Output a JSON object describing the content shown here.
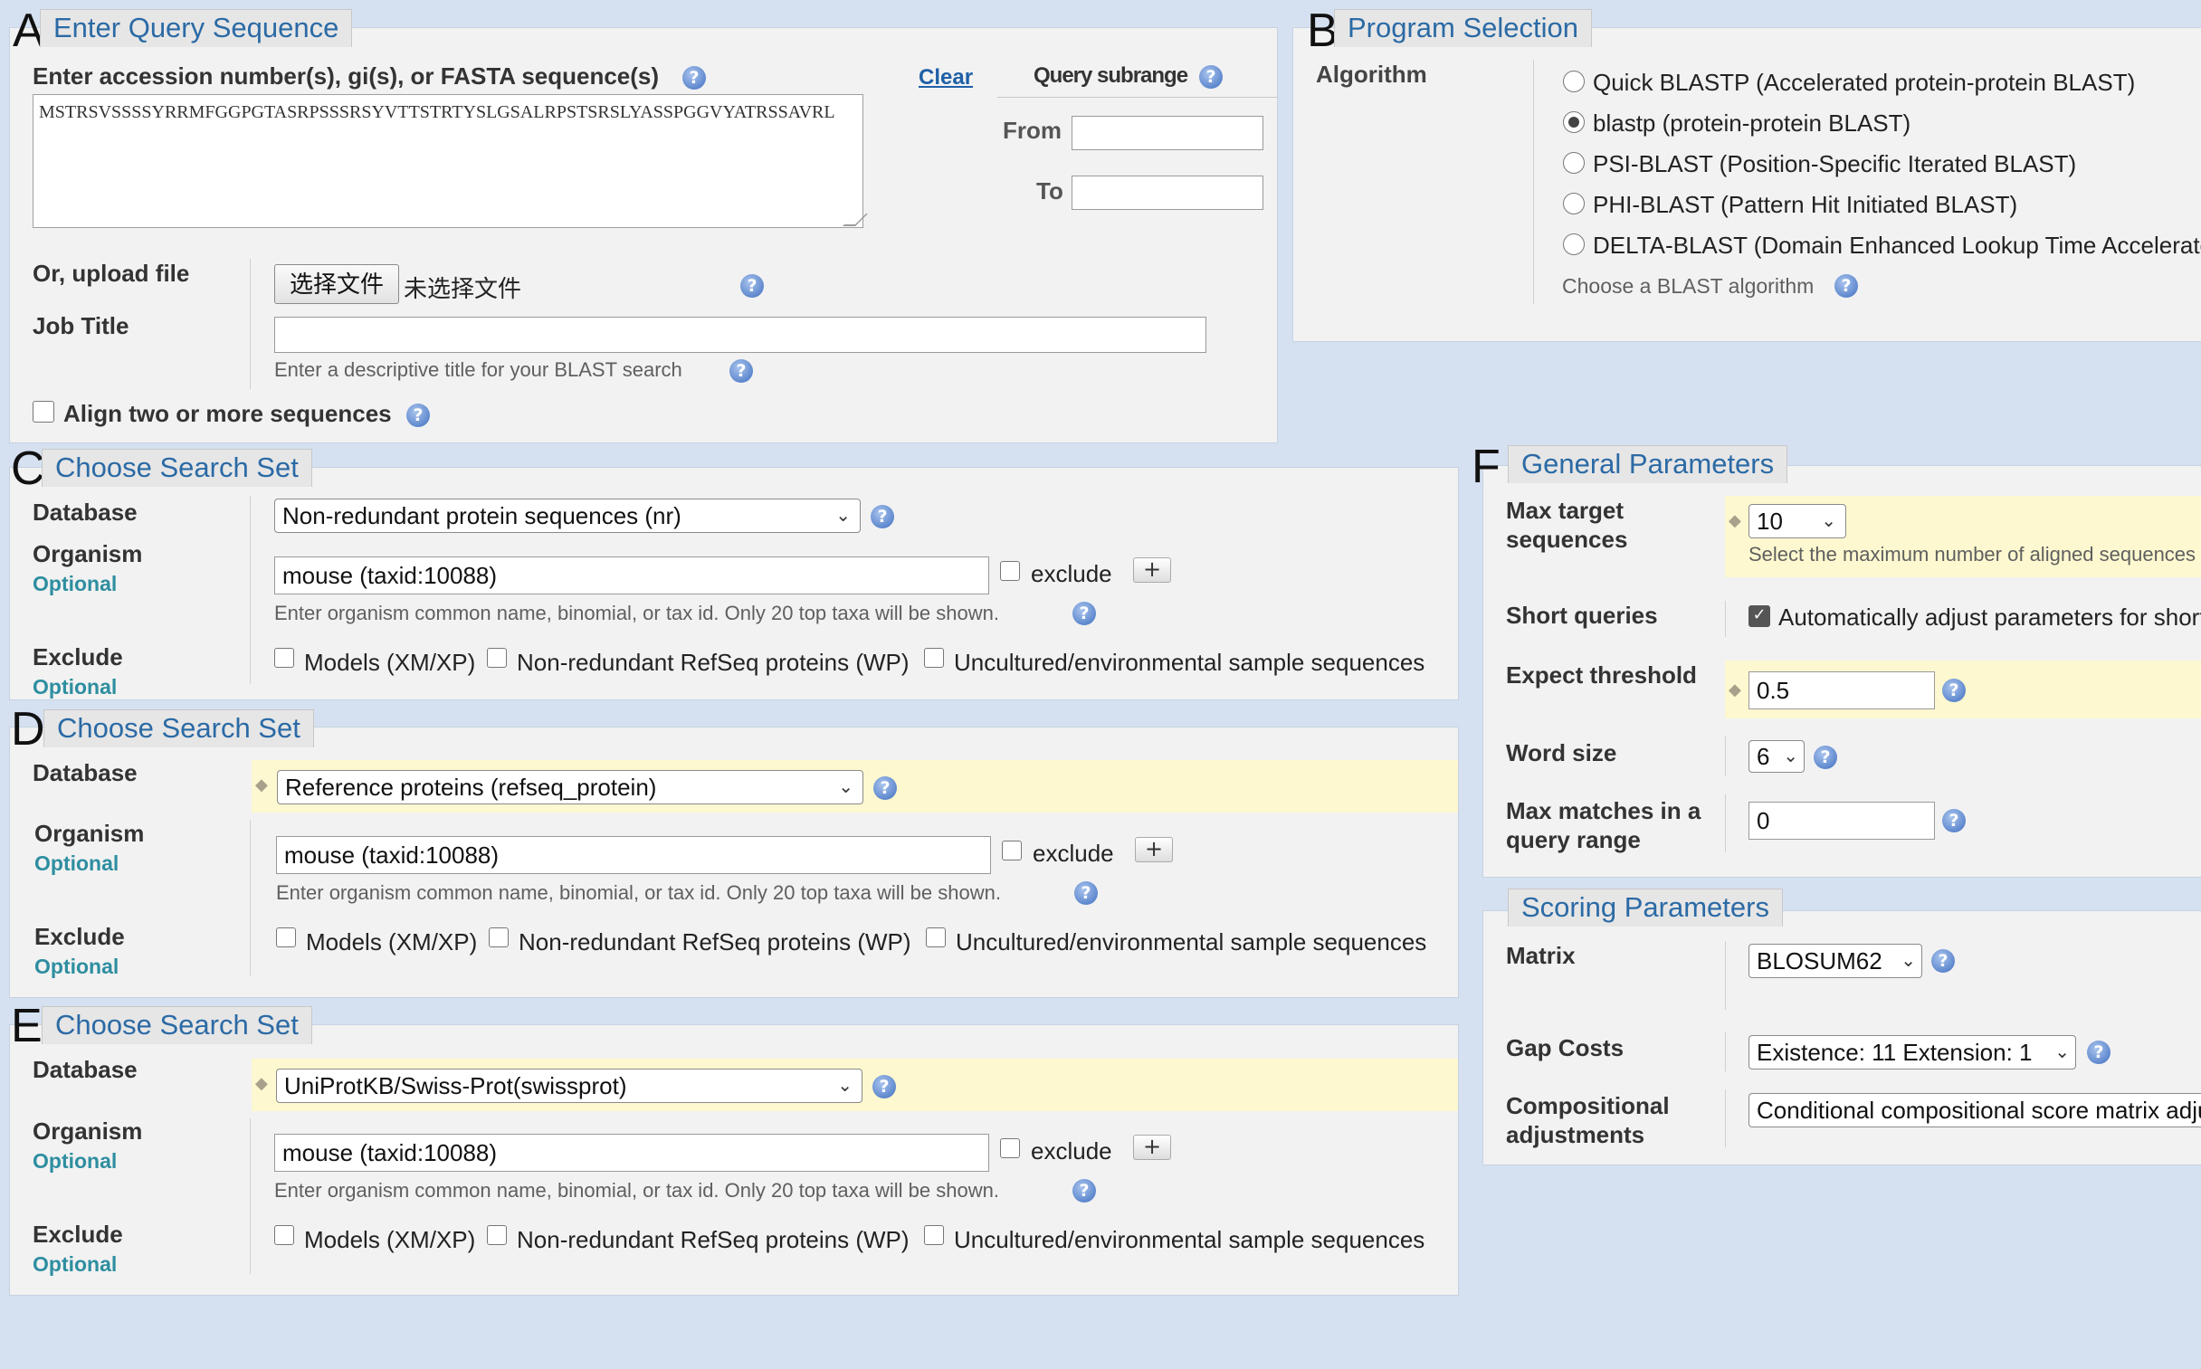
{
  "panelA": {
    "letter": "A",
    "title": "Enter Query Sequence",
    "accession_label": "Enter accession number(s), gi(s), or FASTA sequence(s)",
    "clear_link": "Clear",
    "query_sequence": "MSTRSVSSSSYRRMFGGPGTASRPSSSRSYVTTSTRTYSLGSALRPSTSRSLYASSPGGVYATRSSAVRL",
    "subrange_label": "Query subrange",
    "from_label": "From",
    "to_label": "To",
    "from_value": "",
    "to_value": "",
    "upload_label": "Or, upload file",
    "choose_file_button": "选择文件",
    "no_file_text": "未选择文件",
    "job_title_label": "Job Title",
    "job_title_value": "",
    "job_title_hint": "Enter a descriptive title for your BLAST search",
    "align_two_label": "Align two or more sequences"
  },
  "panelB": {
    "letter": "B",
    "title": "Program Selection",
    "algorithm_label": "Algorithm",
    "options": [
      {
        "label": "Quick BLASTP (Accelerated protein-protein BLAST)",
        "selected": false
      },
      {
        "label": "blastp (protein-protein BLAST)",
        "selected": true
      },
      {
        "label": "PSI-BLAST (Position-Specific Iterated BLAST)",
        "selected": false
      },
      {
        "label": "PHI-BLAST (Pattern Hit Initiated BLAST)",
        "selected": false
      },
      {
        "label": "DELTA-BLAST (Domain Enhanced Lookup Time Accelerated BLAST)",
        "selected": false
      }
    ],
    "hint": "Choose a BLAST algorithm"
  },
  "searchSets": [
    {
      "letter": "C",
      "title": "Choose Search Set",
      "database_label": "Database",
      "database_value": "Non-redundant protein sequences (nr)",
      "organism_label": "Organism",
      "optional_label": "Optional",
      "organism_value": "mouse  (taxid:10088)",
      "exclude_checkbox_label": "exclude",
      "organism_hint": "Enter organism common name, binomial, or tax id. Only 20 top taxa will be shown.",
      "exclude_label": "Exclude",
      "exclude_optional": "Optional",
      "exclude_options": [
        "Models (XM/XP)",
        "Non-redundant RefSeq proteins (WP)",
        "Uncultured/environmental sample sequences"
      ],
      "plus_symbol": "+"
    },
    {
      "letter": "D",
      "title": "Choose Search Set",
      "database_label": "Database",
      "database_value": "Reference proteins (refseq_protein)",
      "organism_label": "Organism",
      "optional_label": "Optional",
      "organism_value": "mouse  (taxid:10088)",
      "exclude_checkbox_label": "exclude",
      "organism_hint": "Enter organism common name, binomial, or tax id. Only 20 top taxa will be shown.",
      "exclude_label": "Exclude",
      "exclude_optional": "Optional",
      "exclude_options": [
        "Models (XM/XP)",
        "Non-redundant RefSeq proteins (WP)",
        "Uncultured/environmental sample sequences"
      ],
      "plus_symbol": "+"
    },
    {
      "letter": "E",
      "title": "Choose Search Set",
      "database_label": "Database",
      "database_value": "UniProtKB/Swiss-Prot(swissprot)",
      "organism_label": "Organism",
      "optional_label": "Optional",
      "organism_value": "mouse  (taxid:10088)",
      "exclude_checkbox_label": "exclude",
      "organism_hint": "Enter organism common name, binomial, or tax id. Only 20 top taxa will be shown.",
      "exclude_label": "Exclude",
      "exclude_optional": "Optional",
      "exclude_options": [
        "Models (XM/XP)",
        "Non-redundant RefSeq proteins (WP)",
        "Uncultured/environmental sample sequences"
      ],
      "plus_symbol": "+"
    }
  ],
  "panelF": {
    "letter": "F",
    "title": "General Parameters",
    "max_target_label_1": "Max target",
    "max_target_label_2": "sequences",
    "max_target_value": "10",
    "max_target_hint": "Select the maximum number of aligned sequences to display",
    "short_queries_label": "Short queries",
    "short_queries_text": "Automatically adjust parameters for short input sequences",
    "expect_label": "Expect threshold",
    "expect_value": "0.5",
    "word_size_label": "Word size",
    "word_size_value": "6",
    "max_matches_label_1": "Max matches in a",
    "max_matches_label_2": "query range",
    "max_matches_value": "0"
  },
  "scoring": {
    "title": "Scoring Parameters",
    "matrix_label": "Matrix",
    "matrix_value": "BLOSUM62",
    "gap_label": "Gap Costs",
    "gap_value": "Existence: 11 Extension: 1",
    "comp_label_1": "Compositional",
    "comp_label_2": "adjustments",
    "comp_value": "Conditional compositional score matrix adjustment"
  },
  "colors": {
    "background": "#d5e1f1",
    "panel": "#f2f2f2",
    "title_text": "#2b6aa5",
    "optional_text": "#2e8ea0",
    "highlight": "#fdf8cf"
  },
  "icons": {
    "help": "question-circle-icon",
    "dropdown": "chevron-down-icon",
    "add": "plus-icon",
    "modified": "diamond-icon"
  }
}
